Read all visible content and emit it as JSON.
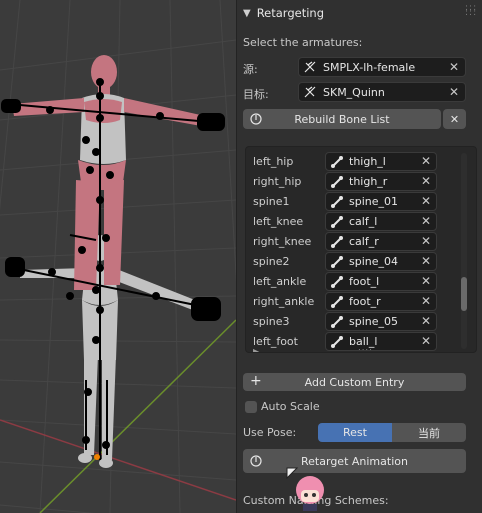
{
  "panel": {
    "title": "Retargeting",
    "select_label": "Select the armatures:",
    "source_label": "源:",
    "source_value": "SMPLX-lh-female",
    "target_label": "目标:",
    "target_value": "SKM_Quinn",
    "rebuild_label": "Rebuild Bone List",
    "bone_map": [
      {
        "source": "left_hip",
        "target": "thigh_l"
      },
      {
        "source": "right_hip",
        "target": "thigh_r"
      },
      {
        "source": "spine1",
        "target": "spine_01"
      },
      {
        "source": "left_knee",
        "target": "calf_l"
      },
      {
        "source": "right_knee",
        "target": "calf_r"
      },
      {
        "source": "spine2",
        "target": "spine_04"
      },
      {
        "source": "left_ankle",
        "target": "foot_l"
      },
      {
        "source": "right_ankle",
        "target": "foot_r"
      },
      {
        "source": "spine3",
        "target": "spine_05"
      },
      {
        "source": "left_foot",
        "target": "ball_l"
      }
    ],
    "add_entry_label": "Add Custom Entry",
    "auto_scale_label": "Auto Scale",
    "auto_scale_checked": false,
    "use_pose_label": "Use Pose:",
    "pose_options": [
      "Rest",
      "当前"
    ],
    "pose_selected": "Rest",
    "retarget_label": "Retarget Animation",
    "custom_schemes_label": "Custom Naming Schemes:"
  },
  "colors": {
    "accent": "#4772b3",
    "panel_bg": "#303030",
    "field_bg": "#1d1d1d",
    "button_bg": "#545454",
    "body_red": "#c47580",
    "body_white": "#c2c2c2"
  },
  "icons": {
    "header": "chevron-down-icon",
    "armature": "armature-icon",
    "bone": "bone-icon",
    "clear": "x-icon",
    "rebuild": "refresh-icon",
    "add": "plus-icon"
  }
}
